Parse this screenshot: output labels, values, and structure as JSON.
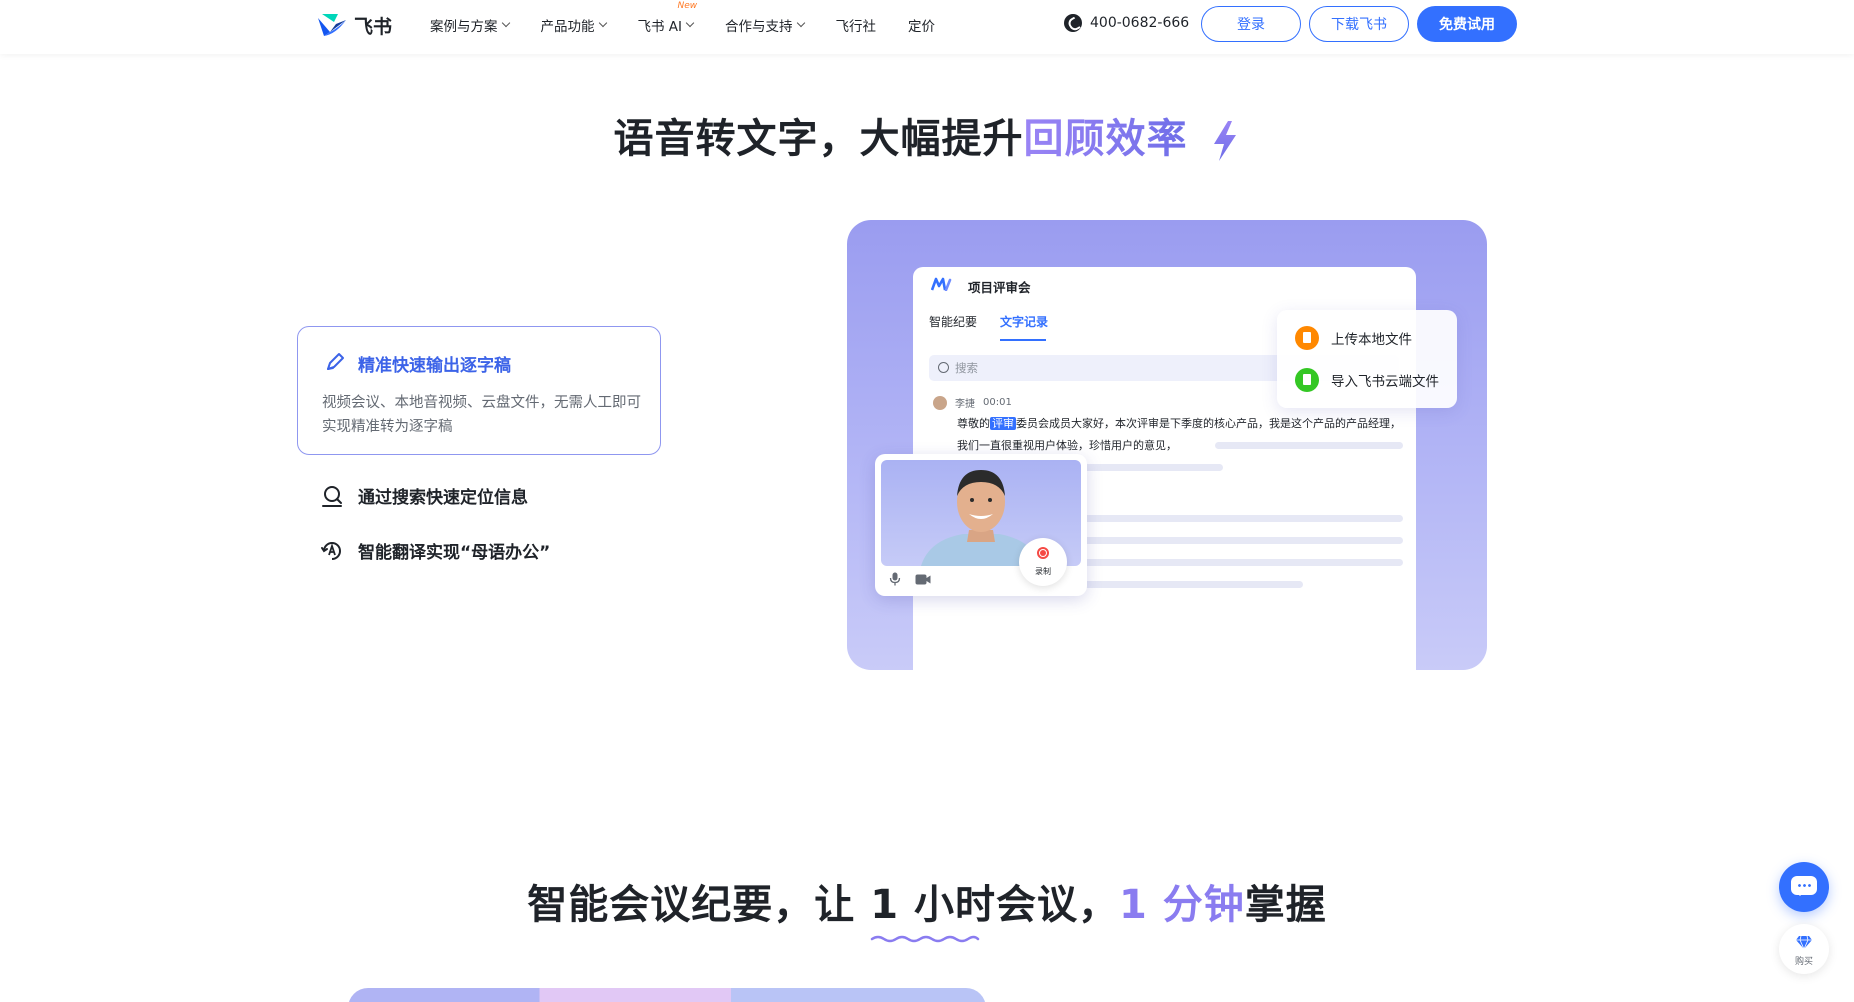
{
  "header": {
    "logo_text": "飞书",
    "nav": [
      {
        "label": "案例与方案",
        "has_dropdown": true
      },
      {
        "label": "产品功能",
        "has_dropdown": true
      },
      {
        "label": "飞书 AI",
        "has_dropdown": true,
        "badge": "New"
      },
      {
        "label": "合作与支持",
        "has_dropdown": true
      },
      {
        "label": "飞行社",
        "has_dropdown": false
      },
      {
        "label": "定价",
        "has_dropdown": false
      }
    ],
    "phone": "400-0682-666",
    "login_label": "登录",
    "download_label": "下载飞书",
    "trial_label": "免费试用"
  },
  "section1": {
    "title_plain": "语音转文字，大幅提升",
    "title_highlight": "回顾效率",
    "features": {
      "active_title": "精准快速输出逐字稿",
      "active_desc": "视频会议、本地音视频、云盘文件，无需人工即可实现精准转为逐字稿",
      "item2": "通过搜索快速定位信息",
      "item3": "智能翻译实现“母语办公”"
    },
    "showcase": {
      "window_title": "项目评审会",
      "tab1": "智能纪要",
      "tab2": "文字记录",
      "search_placeholder": "搜索",
      "speaker_name": "李捷",
      "speaker_time": "00:01",
      "transcript_pre": "尊敬的",
      "transcript_highlight": "评审",
      "transcript_post": "委员会成员大家好，本次评审是下季度的核心产品，我是这个产品的产品经理，我们一直很重视用户体验，珍惜用户的意见，",
      "upload_local": "上传本地文件",
      "import_cloud": "导入飞书云端文件",
      "record_label": "录制"
    }
  },
  "section2": {
    "title_part1": "智能会议纪要，让 ",
    "title_underlined": "1 小时会议",
    "title_part2": "，",
    "title_highlight": "1 分钟",
    "title_part3": "掌握"
  },
  "floating": {
    "buy_label": "购买"
  },
  "colors": {
    "brand_blue": "#3370ff",
    "highlight_purple": "#8a7cf0",
    "showcase_bg": "#9a9cf0"
  }
}
